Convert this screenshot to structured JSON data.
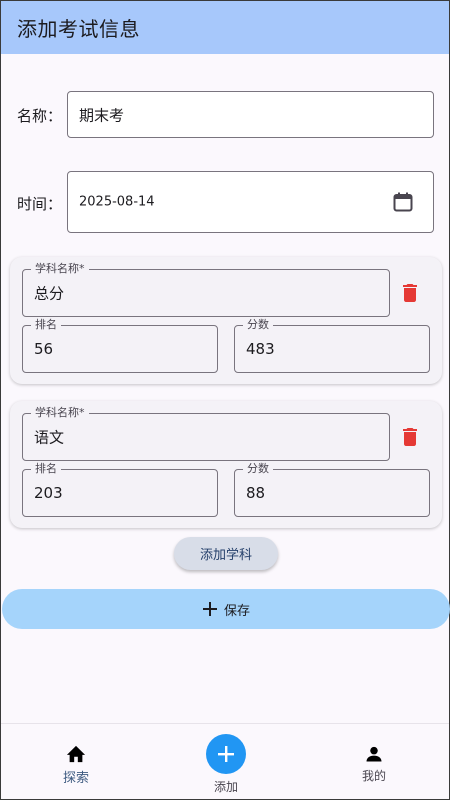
{
  "appbar": {
    "title": "添加考试信息"
  },
  "form": {
    "name_label": "名称：",
    "name_value": "期末考",
    "time_label": "时间：",
    "time_value": "2025-08-14"
  },
  "subjects": [
    {
      "name_label": "学科名称*",
      "name": "总分",
      "rank_label": "排名",
      "rank": "56",
      "score_label": "分数",
      "score": "483"
    },
    {
      "name_label": "学科名称*",
      "name": "语文",
      "rank_label": "排名",
      "rank": "203",
      "score_label": "分数",
      "score": "88"
    }
  ],
  "actions": {
    "add_subject": "添加学科",
    "save": "保存"
  },
  "nav": {
    "items": [
      {
        "label": "探索",
        "icon": "home-icon"
      },
      {
        "label": "添加",
        "icon": "add-icon"
      },
      {
        "label": "我的",
        "icon": "person-icon"
      }
    ]
  },
  "colors": {
    "appbar": "#a7c8fb",
    "save": "#a5d4fb",
    "fab": "#2196f3",
    "delete": "#e53935"
  }
}
